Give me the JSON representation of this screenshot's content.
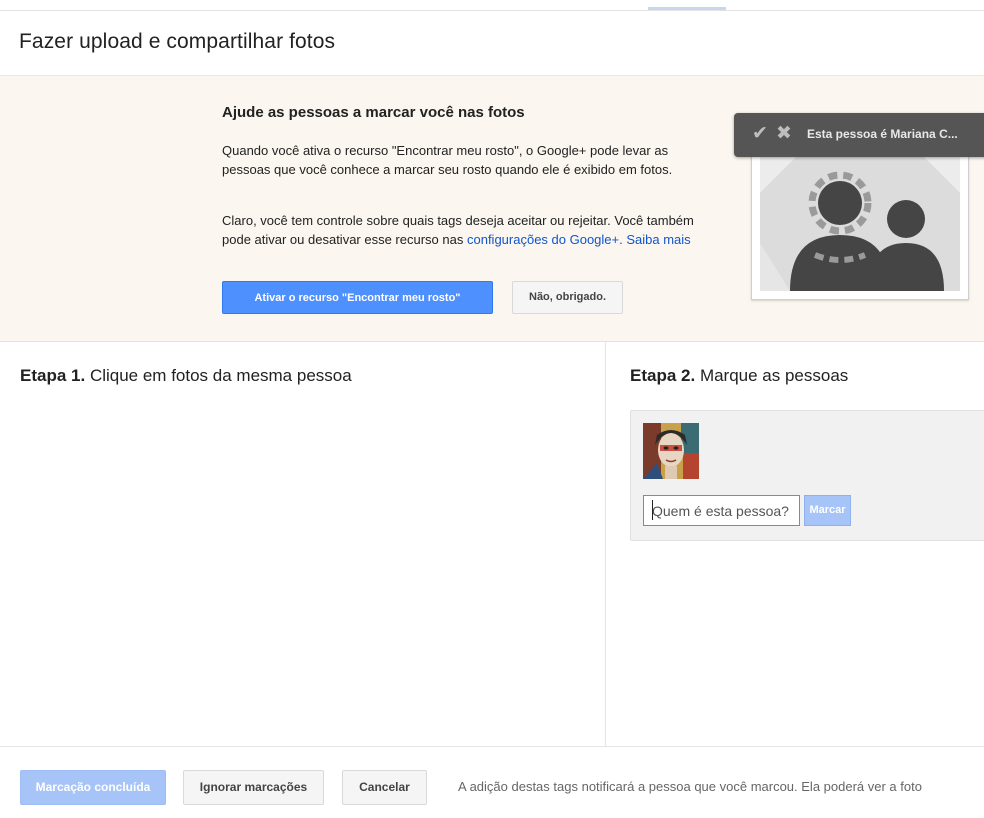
{
  "dialog": {
    "title": "Fazer upload e compartilhar fotos"
  },
  "promo": {
    "heading": "Ajude as pessoas a marcar você nas fotos",
    "paragraph1": "Quando você ativa o recurso \"Encontrar meu rosto\", o Google+ pode levar as pessoas que você conhece a marcar seu rosto quando ele é exibido em fotos.",
    "paragraph2_text": "Claro, você tem controle sobre quais tags deseja aceitar ou rejeitar. Você também pode ativar ou desativar esse recurso nas",
    "settings_link": "configurações do Google+.",
    "learn_more_link": "Saiba mais",
    "enable_button": "Ativar o recurso \"Encontrar meu rosto\"",
    "decline_button": "Não, obrigado.",
    "tag_bar_label": "Esta pessoa é Mariana C...",
    "accent_color": "#4d90fe"
  },
  "step1": {
    "number": "Etapa 1.",
    "text": "Clique em fotos da mesma pessoa"
  },
  "step2": {
    "number": "Etapa 2.",
    "text": "Marque as pessoas",
    "input_placeholder": "Quem é esta pessoa?",
    "mark_button": "Marcar"
  },
  "footer": {
    "done_button": "Marcação concluída",
    "ignore_button": "Ignorar marcações",
    "cancel_button": "Cancelar",
    "note": "A adição destas tags notificará a pessoa que você marcou. Ela poderá ver a foto"
  }
}
